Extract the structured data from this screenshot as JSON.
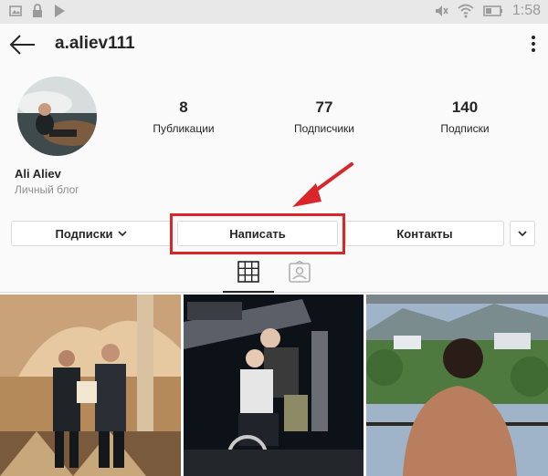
{
  "status_bar": {
    "time": "1:58",
    "left_icons": [
      "image-icon",
      "lock-icon",
      "play-store-icon"
    ],
    "right_icons": [
      "mute-icon",
      "wifi-icon",
      "battery-icon"
    ]
  },
  "header": {
    "username": "a.aliev111"
  },
  "stats": {
    "posts": {
      "value": "8",
      "label": "Публикации"
    },
    "followers": {
      "value": "77",
      "label": "Подписчики"
    },
    "following": {
      "value": "140",
      "label": "Подписки"
    }
  },
  "profile": {
    "name": "Ali Aliev",
    "category": "Личный блог"
  },
  "actions": {
    "following_label": "Подписки",
    "message_label": "Написать",
    "contacts_label": "Контакты"
  },
  "tabs": {
    "grid_icon": "grid-icon",
    "tagged_icon": "tagged-person-icon"
  },
  "colors": {
    "highlight": "#d8262a",
    "text": "#262626",
    "muted": "#8e8e8e",
    "border": "#dbdbdb"
  }
}
